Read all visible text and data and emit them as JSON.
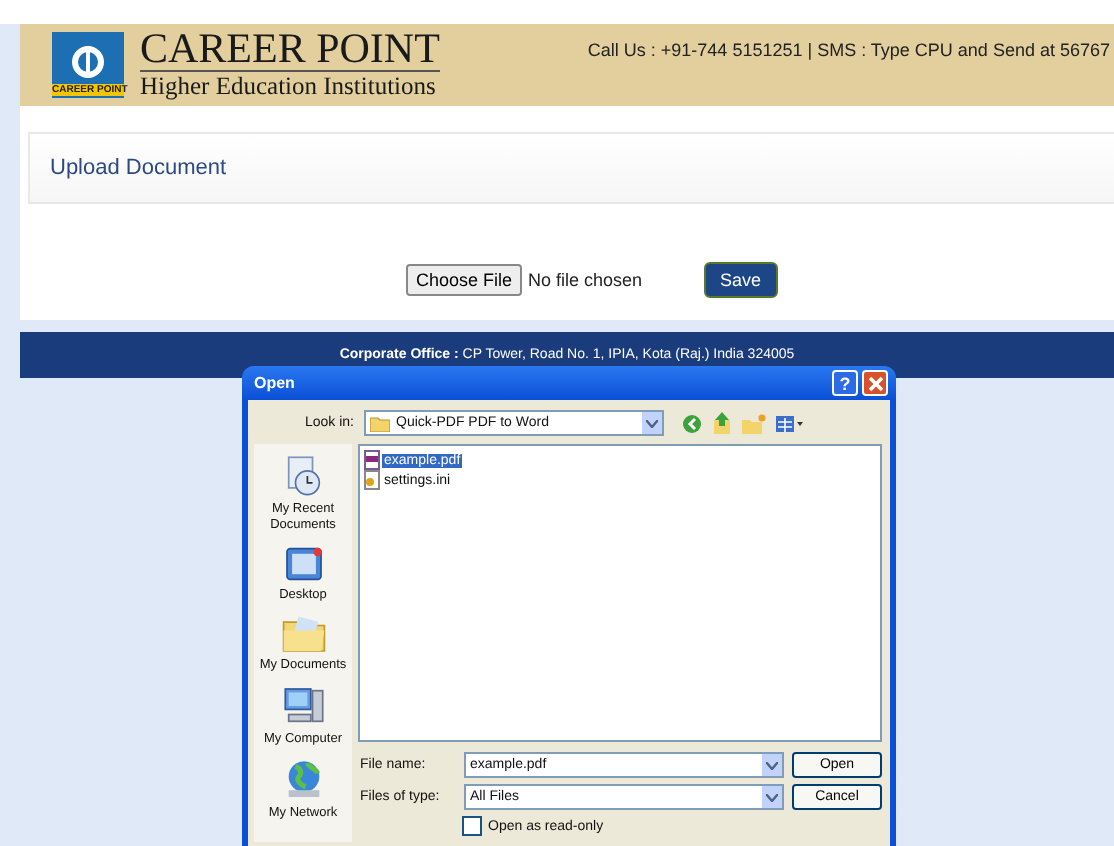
{
  "header": {
    "logo_caption": "CAREER POINT",
    "brand": "CAREER POINT",
    "subtitle": "Higher Education Institutions",
    "contact": "Call Us : +91-744 5151251 | SMS : Type CPU and Send at 56767"
  },
  "panel": {
    "title": "Upload Document"
  },
  "upload": {
    "choose_button": "Choose File",
    "status": "No file chosen",
    "save_button": "Save"
  },
  "footer": {
    "text": "**Corporate Office :** CP Tower, Road No. 1, IPIA, Kota (Raj.) India 324005"
  },
  "dialog": {
    "title": "Open",
    "help": "?",
    "look_in_label": "Look in:",
    "look_in_value": "Quick-PDF PDF to Word",
    "places": [
      {
        "label": "My Recent Documents",
        "kind": "recent"
      },
      {
        "label": "Desktop",
        "kind": "desktop"
      },
      {
        "label": "My Documents",
        "kind": "documents"
      },
      {
        "label": "My Computer",
        "kind": "computer"
      },
      {
        "label": "My Network",
        "kind": "network"
      }
    ],
    "files": [
      {
        "name": "example.pdf",
        "kind": "pdf",
        "selected": true
      },
      {
        "name": "settings.ini",
        "kind": "ini",
        "selected": false
      }
    ],
    "file_name_label": "File name:",
    "file_name_value": "example.pdf",
    "file_type_label": "Files of type:",
    "file_type_value": "All Files",
    "read_only_label": "Open as read-only",
    "read_only_checked": false,
    "open_button": "Open",
    "cancel_button": "Cancel"
  }
}
